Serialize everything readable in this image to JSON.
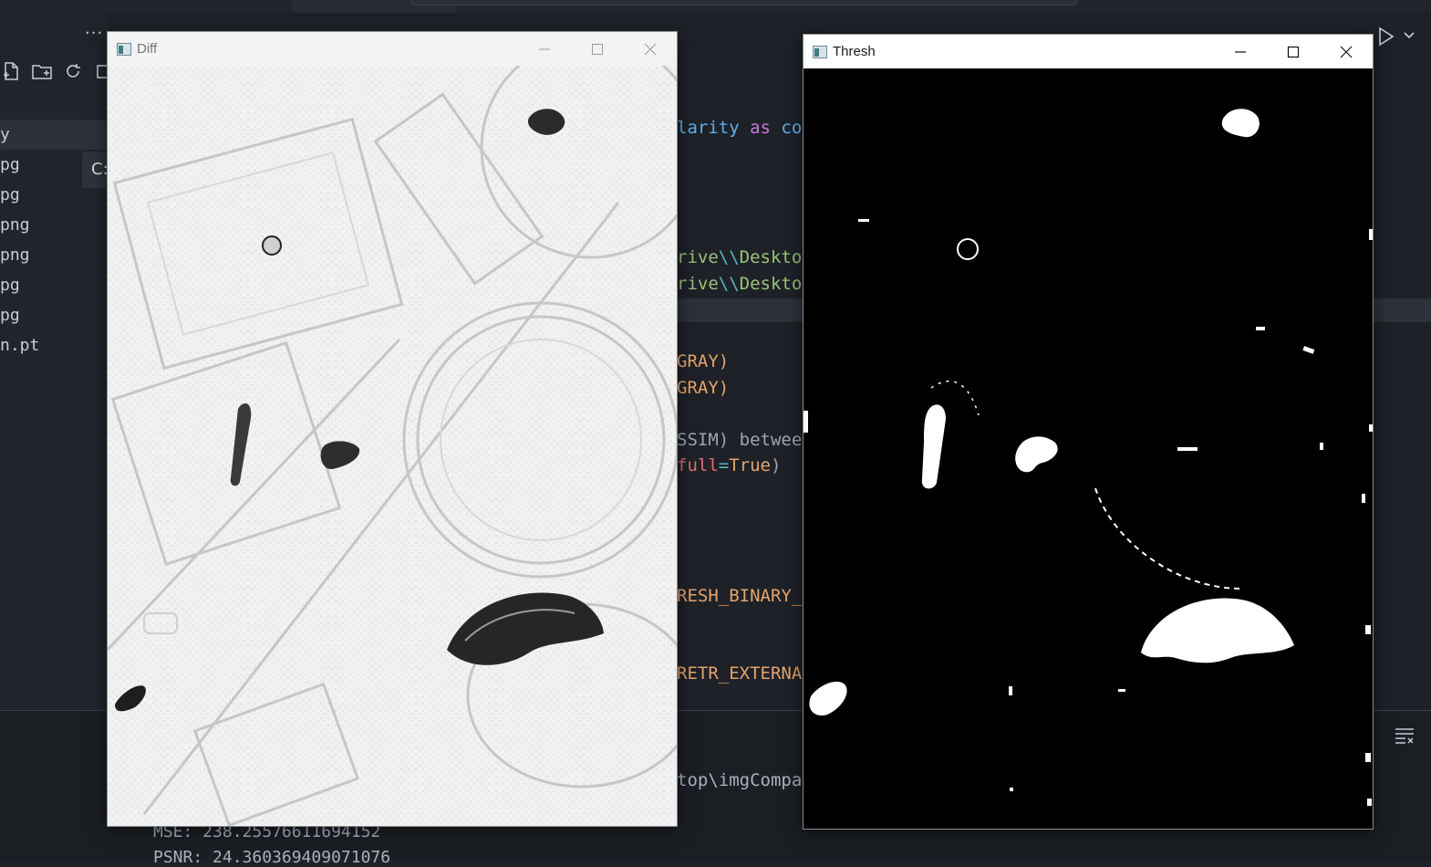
{
  "ide": {
    "more_label": "···",
    "tooltip_text": "C:",
    "files": [
      {
        "label": "y",
        "active": true
      },
      {
        "label": "pg",
        "active": false
      },
      {
        "label": "pg",
        "active": false
      },
      {
        "label": "png",
        "active": false
      },
      {
        "label": "png",
        "active": false
      },
      {
        "label": "pg",
        "active": false
      },
      {
        "label": "pg",
        "active": false
      },
      {
        "label": "n.pt",
        "active": false
      }
    ],
    "code": {
      "l1_a": "larity ",
      "l1_b": "as",
      "l1_c": " con",
      "l2_a": "rive",
      "l2_b": "\\\\",
      "l2_c": "Desktop",
      "l3_a": "rive",
      "l3_b": "\\\\",
      "l3_c": "Desktop",
      "l4": "GRAY)",
      "l5": "GRAY)",
      "l6": "SSIM) between",
      "l7_a": "full",
      "l7_b": "=",
      "l7_c": "True",
      "l7_d": ")",
      "l8": "RESH_BINARY_I",
      "l9": "RETR_EXTERNAL"
    },
    "terminal": {
      "path": "top\\imgCompar",
      "mse": "MSE: 238.25576611694152",
      "psnr": "PSNR: 24.360369409071076"
    }
  },
  "windows": {
    "diff": {
      "title": "Diff"
    },
    "thresh": {
      "title": "Thresh"
    }
  },
  "colors": {
    "editor_bg": "#1e2127",
    "accent_green": "#98c379",
    "accent_blue": "#61afef",
    "accent_orange": "#e5a46b"
  }
}
